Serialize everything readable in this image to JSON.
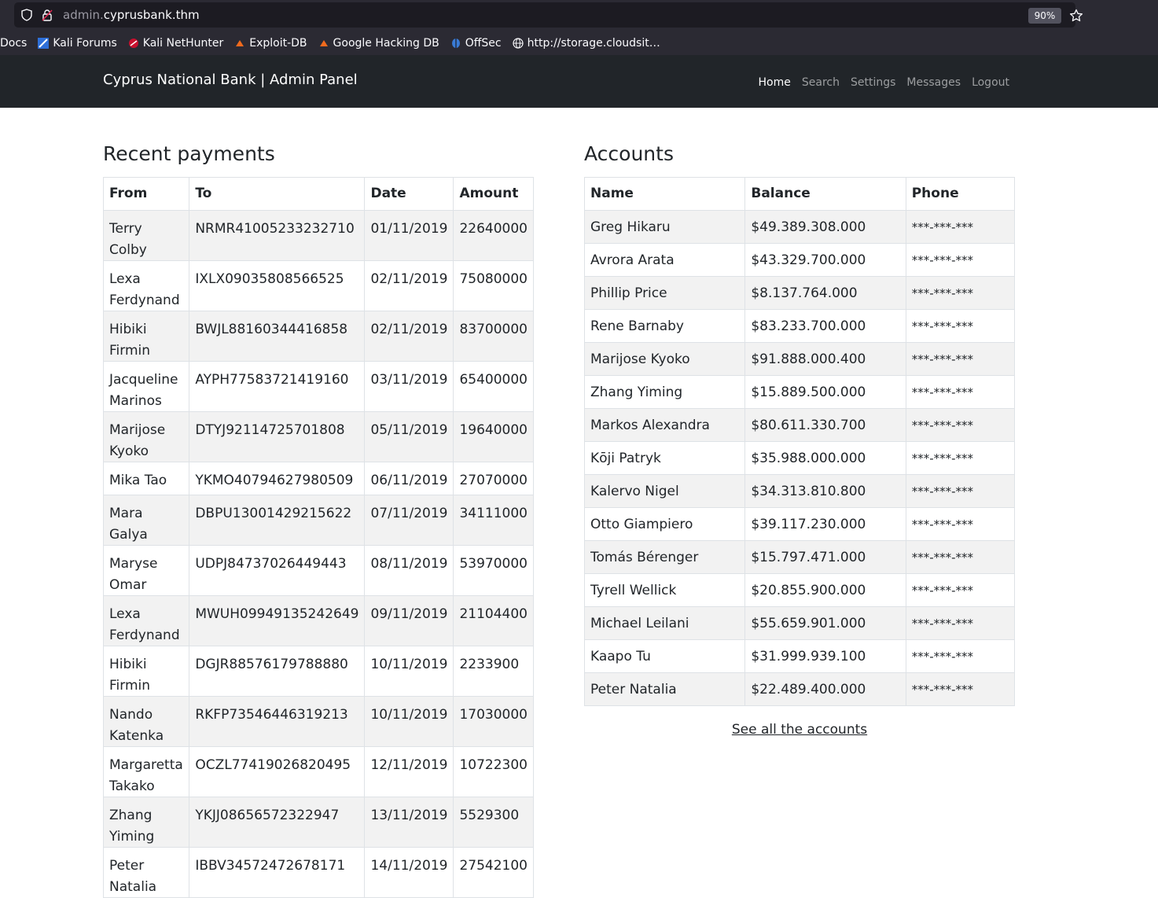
{
  "browser": {
    "url_prefix": "admin.",
    "url_domain": "cyprusbank.thm",
    "zoom": "90%",
    "bookmarks": [
      {
        "label": "Docs",
        "icon": "none"
      },
      {
        "label": "Kali Forums",
        "icon": "kali-icon"
      },
      {
        "label": "Kali NetHunter",
        "icon": "nethunter-icon"
      },
      {
        "label": "Exploit-DB",
        "icon": "exploitdb-icon"
      },
      {
        "label": "Google Hacking DB",
        "icon": "ghdb-icon"
      },
      {
        "label": "OffSec",
        "icon": "offsec-icon"
      },
      {
        "label": "http://storage.cloudsit…",
        "icon": "globe-icon"
      }
    ]
  },
  "navbar": {
    "brand": "Cyprus National Bank | Admin Panel",
    "links": [
      "Home",
      "Search",
      "Settings",
      "Messages",
      "Logout"
    ],
    "active": "Home"
  },
  "payments": {
    "title": "Recent payments",
    "headers": [
      "From",
      "To",
      "Date",
      "Amount"
    ],
    "rows": [
      [
        "Terry Colby",
        "NRMR41005233232710",
        "01/11/2019",
        "22640000"
      ],
      [
        "Lexa Ferdynand",
        "IXLX09035808566525",
        "02/11/2019",
        "75080000"
      ],
      [
        "Hibiki Firmin",
        "BWJL88160344416858",
        "02/11/2019",
        "83700000"
      ],
      [
        "Jacqueline Marinos",
        "AYPH77583721419160",
        "03/11/2019",
        "65400000"
      ],
      [
        "Marijose Kyoko",
        "DTYJ92114725701808",
        "05/11/2019",
        "19640000"
      ],
      [
        "Mika Tao",
        "YKMO40794627980509",
        "06/11/2019",
        "27070000"
      ],
      [
        "Mara Galya",
        "DBPU13001429215622",
        "07/11/2019",
        "34111000"
      ],
      [
        "Maryse Omar",
        "UDPJ84737026449443",
        "08/11/2019",
        "53970000"
      ],
      [
        "Lexa Ferdynand",
        "MWUH09949135242649",
        "09/11/2019",
        "21104400"
      ],
      [
        "Hibiki Firmin",
        "DGJR88576179788880",
        "10/11/2019",
        "2233900"
      ],
      [
        "Nando Katenka",
        "RKFP73546446319213",
        "10/11/2019",
        "17030000"
      ],
      [
        "Margaretta Takako",
        "OCZL77419026820495",
        "12/11/2019",
        "10722300"
      ],
      [
        "Zhang Yiming",
        "YKJJ08656572322947",
        "13/11/2019",
        "5529300"
      ],
      [
        "Peter Natalia",
        "IBBV34572472678171",
        "14/11/2019",
        "27542100"
      ]
    ]
  },
  "accounts": {
    "title": "Accounts",
    "headers": [
      "Name",
      "Balance",
      "Phone"
    ],
    "rows": [
      [
        "Greg Hikaru",
        "$49.389.308.000",
        "***-***-***"
      ],
      [
        "Avrora Arata",
        "$43.329.700.000",
        "***-***-***"
      ],
      [
        "Phillip Price",
        "$8.137.764.000",
        "***-***-***"
      ],
      [
        "Rene Barnaby",
        "$83.233.700.000",
        "***-***-***"
      ],
      [
        "Marijose Kyoko",
        "$91.888.000.400",
        "***-***-***"
      ],
      [
        "Zhang Yiming",
        "$15.889.500.000",
        "***-***-***"
      ],
      [
        "Markos Alexandra",
        "$80.611.330.700",
        "***-***-***"
      ],
      [
        "Kōji Patryk",
        "$35.988.000.000",
        "***-***-***"
      ],
      [
        "Kalervo Nigel",
        "$34.313.810.800",
        "***-***-***"
      ],
      [
        "Otto Giampiero",
        "$39.117.230.000",
        "***-***-***"
      ],
      [
        "Tomás Bérenger",
        "$15.797.471.000",
        "***-***-***"
      ],
      [
        "Tyrell Wellick",
        "$20.855.900.000",
        "***-***-***"
      ],
      [
        "Michael Leilani",
        "$55.659.901.000",
        "***-***-***"
      ],
      [
        "Kaapo Tu",
        "$31.999.939.100",
        "***-***-***"
      ],
      [
        "Peter Natalia",
        "$22.489.400.000",
        "***-***-***"
      ]
    ],
    "see_all": "See all the accounts"
  }
}
